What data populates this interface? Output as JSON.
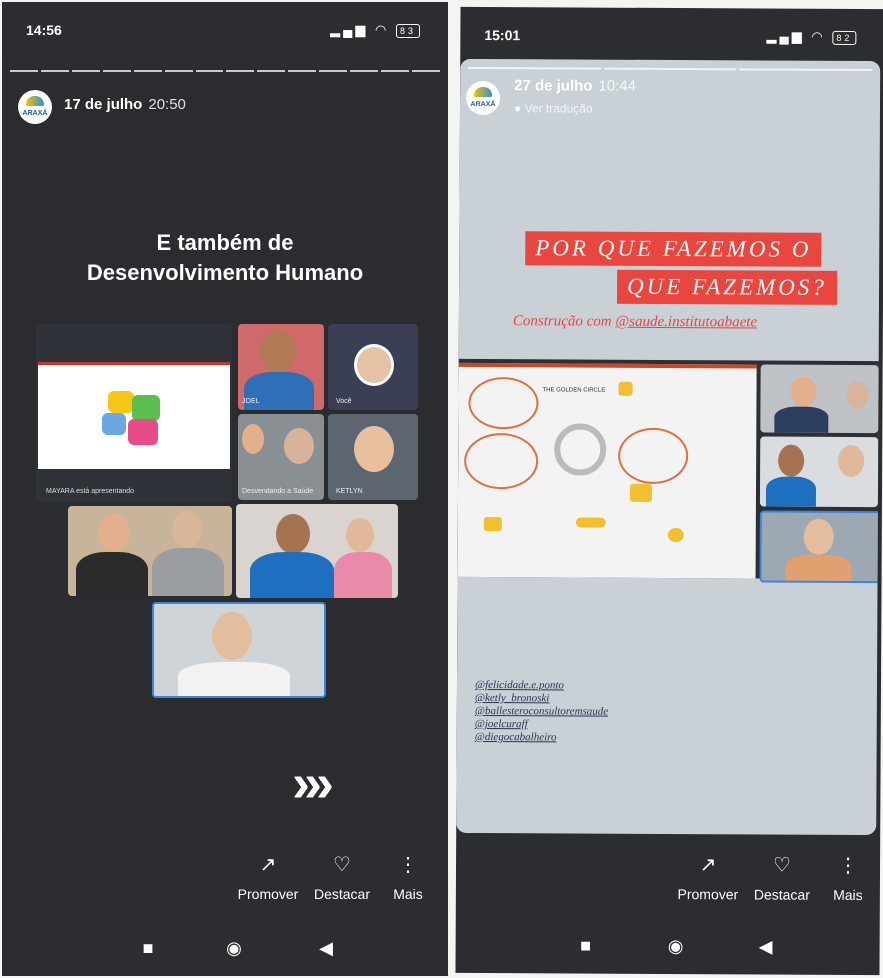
{
  "left_screen": {
    "status_time": "14:56",
    "battery": "83",
    "story_date": "17 de julho",
    "story_hour": "20:50",
    "headline_line1": "E também de",
    "headline_line2": "Desenvolvimento Humano",
    "call": {
      "presenting_caption": "MAYARA está apresentando",
      "tile_labels": [
        "JOEL",
        "Você",
        "Desvendando a Saúde",
        "KETLYN"
      ]
    },
    "arrows": "›››",
    "actions": [
      {
        "label": "Promover",
        "icon": "trending-up-icon"
      },
      {
        "label": "Destacar",
        "icon": "highlight-heart-icon"
      },
      {
        "label": "Mais",
        "icon": "more-vertical-icon"
      }
    ]
  },
  "right_screen": {
    "status_time": "15:01",
    "battery": "82",
    "story_date": "27 de julho",
    "story_hour": "10:44",
    "see_translation": "Ver tradução",
    "banner_line1": "POR QUE FAZEMOS O",
    "banner_line2": "QUE FAZEMOS?",
    "subtitle_prefix": "Construção com ",
    "subtitle_handle": "@saude.institutoabaete",
    "whiteboard_title": "THE GOLDEN CIRCLE",
    "mentions": [
      "@felicidade.e.ponto",
      "@ketly_bronoski",
      "@ballesteroconsultoremsaude",
      "@joelcuraff",
      "@diegocabalheiro"
    ],
    "actions": [
      {
        "label": "Promover",
        "icon": "trending-up-icon"
      },
      {
        "label": "Destacar",
        "icon": "highlight-heart-icon"
      },
      {
        "label": "Mais",
        "icon": "more-vertical-icon"
      }
    ]
  },
  "colors": {
    "story_dark": "#2b2d30",
    "banner_red": "#e8463f",
    "story_light": "#c9d0d6"
  }
}
